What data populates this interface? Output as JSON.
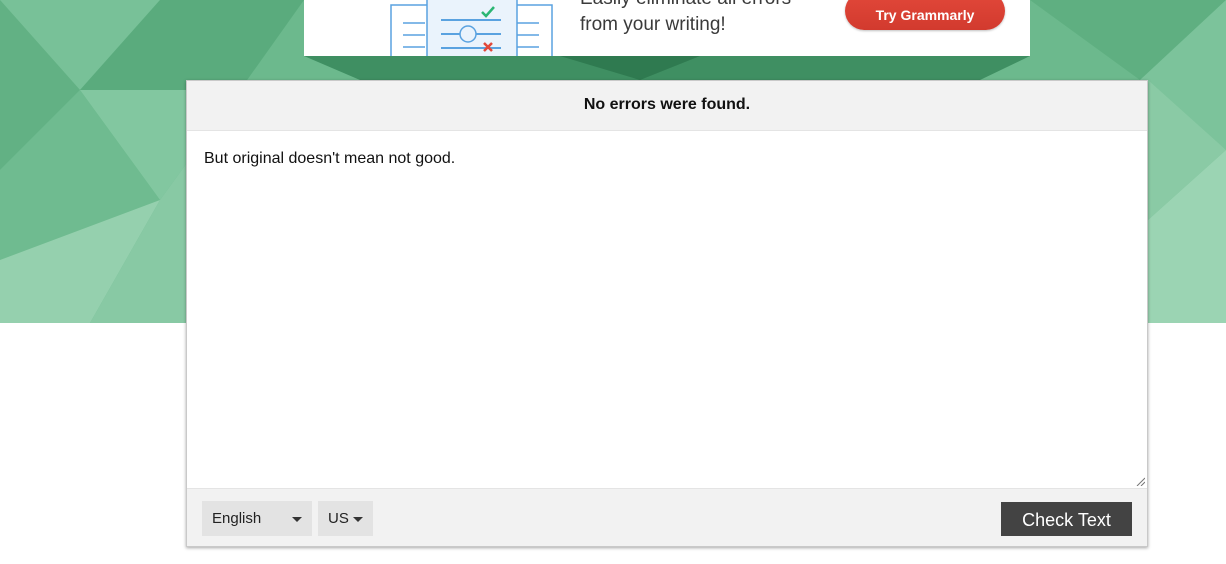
{
  "ad": {
    "line1": "Easily eliminate all errors",
    "line2": "from your writing!",
    "cta_label": "Try Grammarly",
    "cta_color": "#d8402f"
  },
  "checker": {
    "status_message": "No errors were found.",
    "input_text": "But original doesn't mean not good.",
    "language": "English",
    "region": "US",
    "check_button_label": "Check Text"
  },
  "theme": {
    "hero_green": "#6cb98d",
    "button_dark": "#434343"
  }
}
